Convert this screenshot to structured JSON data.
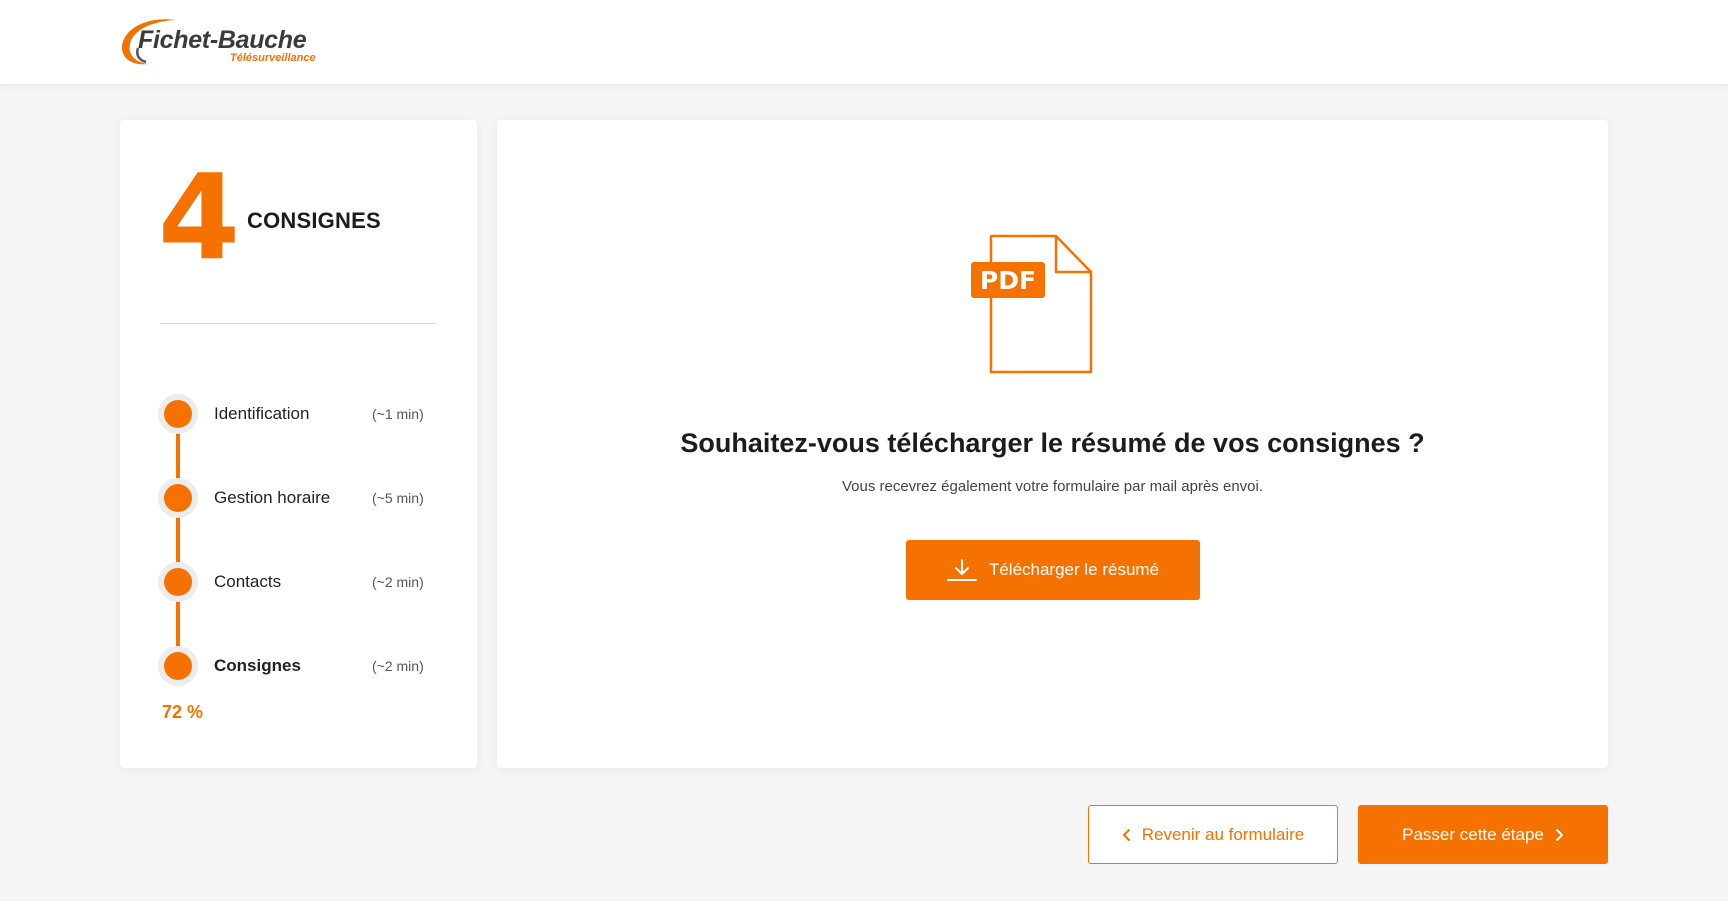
{
  "header": {
    "brand": "Fichet-Bauche",
    "subtitle": "Télésurveillance"
  },
  "sidebar": {
    "step_number": "4",
    "step_title": "CONSIGNES",
    "steps": [
      {
        "label": "Identification",
        "time": "(~1 min)",
        "active": false
      },
      {
        "label": "Gestion horaire",
        "time": "(~5 min)",
        "active": false
      },
      {
        "label": "Contacts",
        "time": "(~2 min)",
        "active": false
      },
      {
        "label": "Consignes",
        "time": "(~2 min)",
        "active": true
      }
    ],
    "progress_text": "72 %",
    "progress_value": 72
  },
  "main": {
    "pdf_label": "PDF",
    "question": "Souhaitez-vous télécharger le résumé de vos consignes ?",
    "subtext": "Vous recevrez également votre formulaire par mail après envoi.",
    "download_label": "Télécharger le résumé"
  },
  "footer": {
    "back_label": "Revenir au formulaire",
    "skip_label": "Passer cette étape"
  },
  "colors": {
    "accent": "#f57200",
    "background": "#f5f5f5",
    "card": "#ffffff"
  },
  "icons": {
    "logo": "fichet-bauche-logo",
    "pdf": "pdf-file-icon",
    "download": "download-icon",
    "back": "chevron-left-icon",
    "next": "chevron-right-icon"
  }
}
